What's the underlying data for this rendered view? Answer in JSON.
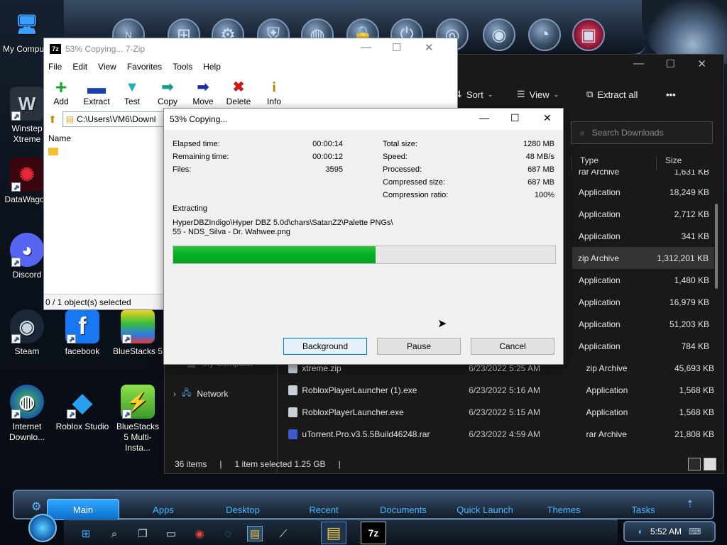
{
  "desktop": {
    "icons": [
      {
        "label": "My Compu...",
        "glyph": "🖥",
        "color": "#2a7bd8"
      },
      {
        "label": "Winstep Xtreme",
        "glyph": "W",
        "color": "#3d4652"
      },
      {
        "label": "DataWagon",
        "glyph": "✺",
        "color": "#8a0d1d"
      },
      {
        "label": "Discord",
        "glyph": "◕",
        "color": "#5865f2"
      },
      {
        "label": "Steam",
        "glyph": "◉",
        "color": "#1b2838"
      },
      {
        "label": "facebook",
        "glyph": "f",
        "color": "#1877f2"
      },
      {
        "label": "BlueStacks 5",
        "glyph": "▰",
        "color": "#3da034"
      },
      {
        "label": "Internet Downlo...",
        "glyph": "◍",
        "color": "#2f8a3b"
      },
      {
        "label": "Roblox Studio",
        "glyph": "◆",
        "color": "#1d8ee0"
      },
      {
        "label": "BlueStacks 5 Multi-Insta...",
        "glyph": "▰",
        "color": "#6cc63c"
      }
    ],
    "dock_icons": [
      "nexus-icon",
      "windows-icon",
      "settings-icon",
      "defender-icon",
      "globe-icon",
      "lock-icon",
      "power-icon",
      "media-icon",
      "camera-icon",
      "speedometer-icon",
      "color-icon"
    ]
  },
  "explorer": {
    "commands": {
      "sort": "Sort",
      "view": "View",
      "extract_all": "Extract all",
      "more": "•••"
    },
    "search_placeholder": "Search Downloads",
    "columns": {
      "type": "Type",
      "size": "Size"
    },
    "partial_top": {
      "type": "rar Archive",
      "size": "1,631 KB"
    },
    "rows": [
      {
        "type": "Application",
        "size": "18,249 KB",
        "selected": false
      },
      {
        "type": "Application",
        "size": "2,712 KB",
        "selected": false
      },
      {
        "type": "Application",
        "size": "341 KB",
        "selected": false
      },
      {
        "type": "zip Archive",
        "size": "1,312,201 KB",
        "selected": true
      },
      {
        "type": "Application",
        "size": "1,480 KB",
        "selected": false
      },
      {
        "type": "Application",
        "size": "16,979 KB",
        "selected": false
      },
      {
        "type": "Application",
        "size": "51,203 KB",
        "selected": false
      },
      {
        "type": "Application",
        "size": "784 KB",
        "selected": false
      }
    ],
    "files": [
      {
        "name": "xtreme.zip",
        "date": "6/23/2022 5:25 AM",
        "type": "zip Archive",
        "size": "45,693 KB"
      },
      {
        "name": "RobloxPlayerLauncher (1).exe",
        "date": "6/23/2022 5:16 AM",
        "type": "Application",
        "size": "1,568 KB"
      },
      {
        "name": "RobloxPlayerLauncher.exe",
        "date": "6/23/2022 5:15 AM",
        "type": "Application",
        "size": "1,568 KB"
      },
      {
        "name": "uTorrent.Pro.v3.5.5Build46248.rar",
        "date": "6/23/2022 4:59 AM",
        "type": "rar Archive",
        "size": "21,808 KB"
      }
    ],
    "nav": {
      "my_computer": "My Computer",
      "network": "Network"
    },
    "status": {
      "items": "36 items",
      "selected": "1 item selected  1.25 GB"
    }
  },
  "zip": {
    "title": "53% Copying... 7-Zip",
    "logo": "7z",
    "menu": [
      "File",
      "Edit",
      "View",
      "Favorites",
      "Tools",
      "Help"
    ],
    "toolbar": [
      {
        "label": "Add",
        "icon": "+",
        "color": "#1aa52a"
      },
      {
        "label": "Extract",
        "icon": "━",
        "color": "#1c3fb0"
      },
      {
        "label": "Test",
        "icon": "▼",
        "color": "#20b0b0"
      },
      {
        "label": "Copy",
        "icon": "➡",
        "color": "#1a9a8a"
      },
      {
        "label": "Move",
        "icon": "➡",
        "color": "#1c2fa0"
      },
      {
        "label": "Delete",
        "icon": "✖",
        "color": "#d01818"
      },
      {
        "label": "Info",
        "icon": "i",
        "color": "#b08a00"
      }
    ],
    "path": "C:\\Users\\VM6\\Downl",
    "column_name": "Name",
    "status": "0 / 1 object(s) selected"
  },
  "dialog": {
    "title": "53% Copying...",
    "left_stats": [
      {
        "label": "Elapsed time:",
        "value": "00:00:14"
      },
      {
        "label": "Remaining time:",
        "value": "00:00:12"
      },
      {
        "label": "Files:",
        "value": "3595"
      }
    ],
    "right_stats": [
      {
        "label": "Total size:",
        "value": "1280 MB"
      },
      {
        "label": "Speed:",
        "value": "48 MB/s"
      },
      {
        "label": "Processed:",
        "value": "687 MB"
      },
      {
        "label": "Compressed size:",
        "value": "687 MB"
      },
      {
        "label": "Compression ratio:",
        "value": "100%"
      }
    ],
    "operation": "Extracting",
    "path_line1": "HyperDBZIndigo\\Hyper DBZ 5.0d\\chars\\SatanZ2\\Palette PNGs\\",
    "path_line2": "55 - NDS_Silva - Dr. Wahwee.png",
    "progress": 0.53,
    "buttons": {
      "background": "Background",
      "pause": "Pause",
      "cancel": "Cancel"
    }
  },
  "themebar": {
    "tabs": [
      "Main",
      "Apps",
      "Desktop",
      "Recent",
      "Documents",
      "Quick Launch",
      "Themes",
      "Tasks"
    ],
    "active": "Main"
  },
  "taskbar": {
    "clock": "5:52 AM",
    "zip_label": "7z"
  }
}
